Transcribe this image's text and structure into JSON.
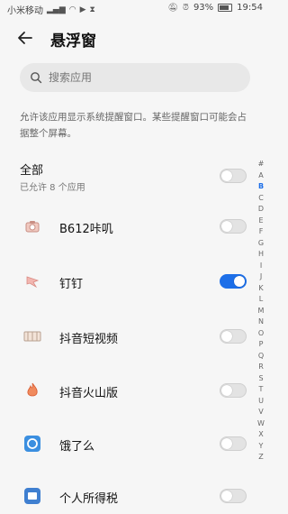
{
  "status_bar": {
    "carrier": "小米移动",
    "battery": "93%",
    "time": "19:54"
  },
  "header": {
    "title": "悬浮窗"
  },
  "search": {
    "placeholder": "搜索应用"
  },
  "description": "允许该应用显示系统提醒窗口。某些提醒窗口可能会占据整个屏幕。",
  "all": {
    "title": "全部",
    "subtitle": "已允许 8 个应用",
    "enabled": false
  },
  "apps": [
    {
      "name": "B612咔叽",
      "icon": "b612-camera-icon",
      "enabled": false
    },
    {
      "name": "钉钉",
      "icon": "dingtalk-icon",
      "enabled": true
    },
    {
      "name": "抖音短视频",
      "icon": "douyin-icon",
      "enabled": false
    },
    {
      "name": "抖音火山版",
      "icon": "douyin-huoshan-icon",
      "enabled": false
    },
    {
      "name": "饿了么",
      "icon": "eleme-icon",
      "enabled": false
    },
    {
      "name": "个人所得税",
      "icon": "tax-app-icon",
      "enabled": false
    }
  ],
  "alphabet": [
    "#",
    "A",
    "B",
    "C",
    "D",
    "E",
    "F",
    "G",
    "H",
    "I",
    "J",
    "K",
    "L",
    "M",
    "N",
    "O",
    "P",
    "Q",
    "R",
    "S",
    "T",
    "U",
    "V",
    "W",
    "X",
    "Y",
    "Z"
  ],
  "alphabet_active": "B",
  "colors": {
    "accent": "#1d6fe8",
    "background": "#f6f6f6"
  }
}
